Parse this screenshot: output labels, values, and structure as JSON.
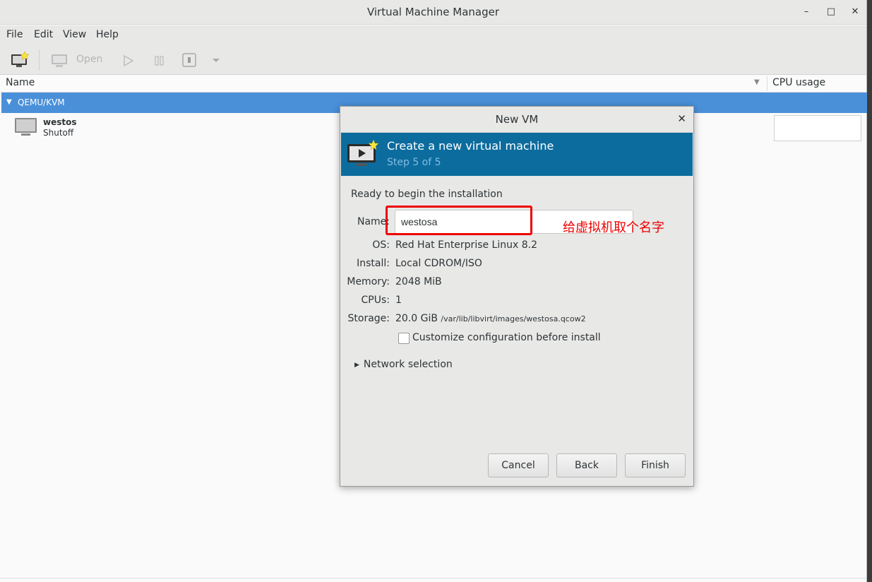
{
  "window": {
    "title": "Virtual Machine Manager"
  },
  "menu": {
    "file": "File",
    "edit": "Edit",
    "view": "View",
    "help": "Help"
  },
  "toolbar": {
    "open_label": "Open"
  },
  "columns": {
    "name": "Name",
    "cpu": "CPU usage"
  },
  "group": {
    "label": "QEMU/KVM"
  },
  "vm": {
    "name": "westos",
    "status": "Shutoff"
  },
  "dialog": {
    "title": "New VM",
    "header": "Create a new virtual machine",
    "step": "Step 5 of 5",
    "ready": "Ready to begin the installation",
    "labels": {
      "name": "Name:",
      "os": "OS:",
      "install": "Install:",
      "memory": "Memory:",
      "cpus": "CPUs:",
      "storage": "Storage:"
    },
    "values": {
      "name": "westosa",
      "os": "Red Hat Enterprise Linux 8.2",
      "install": "Local CDROM/ISO",
      "memory": "2048 MiB",
      "cpus": "1",
      "storage_size": "20.0 GiB",
      "storage_path": "/var/lib/libvirt/images/westosa.qcow2"
    },
    "customize": "Customize configuration before install",
    "network": "Network selection",
    "buttons": {
      "cancel": "Cancel",
      "back": "Back",
      "finish": "Finish"
    }
  },
  "annotation": {
    "text": "给虚拟机取个名字",
    "color": "#ee0000"
  }
}
